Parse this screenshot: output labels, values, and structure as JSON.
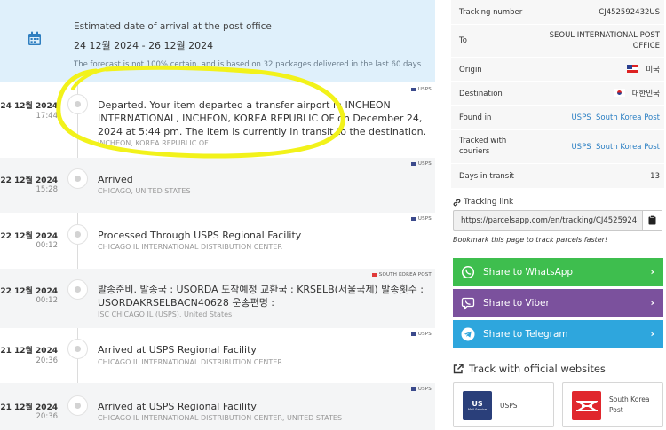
{
  "eta": {
    "title": "Estimated date of arrival at the post office",
    "range": "24 12월 2024 - 26 12월 2024",
    "note": "The forecast is not 100% certain, and is based on 32 packages delivered in the last 60 days"
  },
  "events": [
    {
      "date": "24 12월 2024",
      "time": "17:44",
      "carrier": "USPS",
      "carrier_flag": "us",
      "desc": "Departed. Your item departed a transfer airport in INCHEON INTERNATIONAL, INCHEON, KOREA REPUBLIC OF on December 24, 2024 at 5:44 pm. The item is currently in transit to the destination.",
      "loc": "INCHEON, KOREA REPUBLIC OF"
    },
    {
      "date": "22 12월 2024",
      "time": "15:28",
      "carrier": "USPS",
      "carrier_flag": "us",
      "desc": "Arrived",
      "loc": "CHICAGO, UNITED STATES"
    },
    {
      "date": "22 12월 2024",
      "time": "00:12",
      "carrier": "USPS",
      "carrier_flag": "us",
      "desc": "Processed Through USPS Regional Facility",
      "loc": "CHICAGO IL INTERNATIONAL DISTRIBUTION CENTER"
    },
    {
      "date": "22 12월 2024",
      "time": "00:12",
      "carrier": "SOUTH KOREA POST",
      "carrier_flag": "kr",
      "desc": "발송준비. 발송국 : USORDA 도착예정 교환국 : KRSELB(서울국제) 발송횟수 : USORDAKRSELBACN40628 운송편명 :",
      "loc": "ISC CHICAGO IL (USPS), United States"
    },
    {
      "date": "21 12월 2024",
      "time": "20:36",
      "carrier": "USPS",
      "carrier_flag": "us",
      "desc": "Arrived at USPS Regional Facility",
      "loc": "CHICAGO IL INTERNATIONAL DISTRIBUTION CENTER"
    },
    {
      "date": "21 12월 2024",
      "time": "20:36",
      "carrier": "USPS",
      "carrier_flag": "us",
      "desc": "Arrived at USPS Regional Facility",
      "loc": "CHICAGO IL INTERNATIONAL DISTRIBUTION CENTER, UNITED STATES"
    }
  ],
  "info": {
    "tracking_number_label": "Tracking number",
    "tracking_number": "CJ452592432US",
    "to_label": "To",
    "to": "SEOUL INTERNATIONAL POST OFFICE",
    "origin_label": "Origin",
    "origin": "미국",
    "destination_label": "Destination",
    "destination": "대한민국",
    "found_in_label": "Found in",
    "found_in_1": "USPS",
    "found_in_2": "South Korea Post",
    "tracked_with_label": "Tracked with couriers",
    "tracked_with_1": "USPS",
    "tracked_with_2": "South Korea Post",
    "days_label": "Days in transit",
    "days": "13"
  },
  "tracking_link": {
    "label": "Tracking link",
    "url": "https://parcelsapp.com/en/tracking/CJ4525924",
    "bookmark": "Bookmark this page to track parcels faster!"
  },
  "share": {
    "whatsapp": "Share to WhatsApp",
    "viber": "Share to Viber",
    "telegram": "Share to Telegram"
  },
  "official": {
    "title": "Track with official websites",
    "usps_name": "USPS",
    "usps_logo_1": "US",
    "usps_logo_2": "Mail Service",
    "kp_name_1": "South Korea",
    "kp_name_2": "Post"
  },
  "colors": {
    "eta_bg": "#dff0fb",
    "whatsapp": "#3ebe4e",
    "viber": "#7b519d",
    "telegram": "#2ea6dd",
    "link": "#2b7fc3",
    "highlight": "#f2f21a"
  }
}
